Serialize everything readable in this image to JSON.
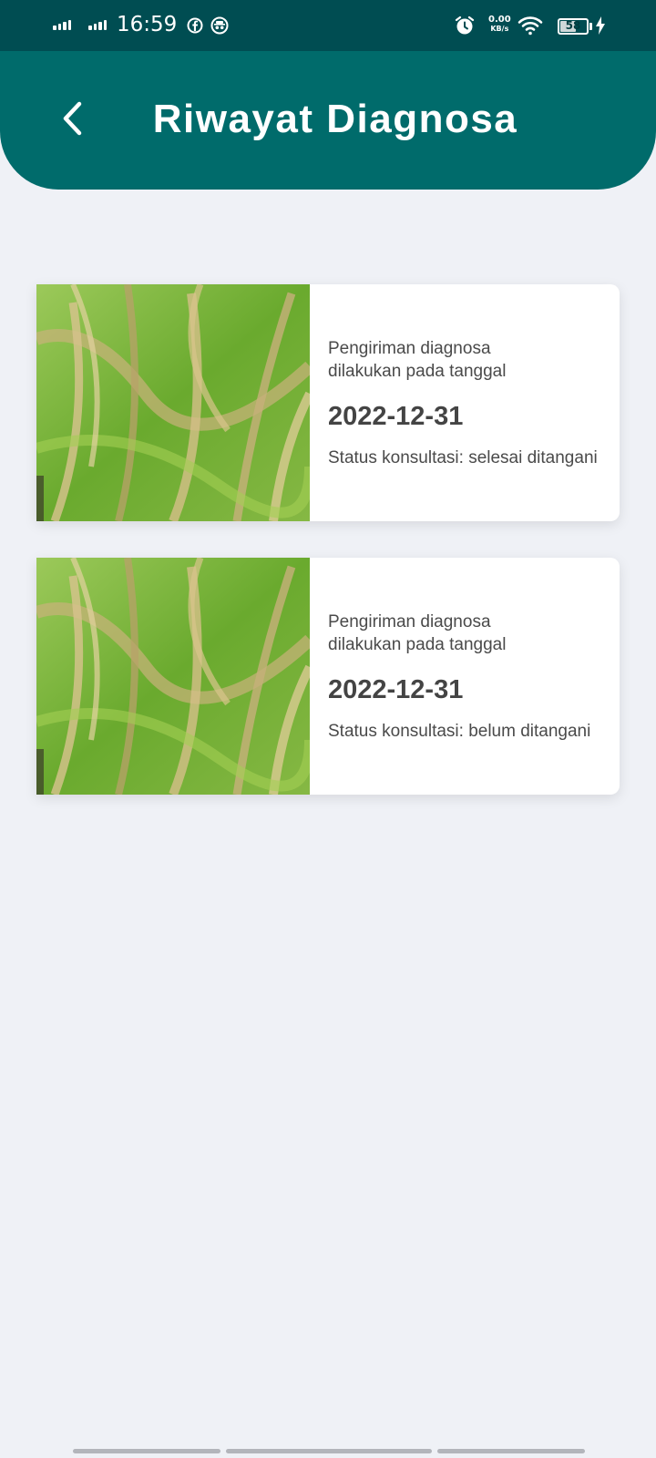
{
  "status_bar": {
    "time": "16:59",
    "network_speed_value": "0.00",
    "network_speed_unit": "KB/s",
    "battery_level": "58",
    "icons": [
      "signal-icon",
      "signal-icon",
      "facebook-icon",
      "incognito-icon",
      "alarm-icon",
      "wifi-icon",
      "battery-icon",
      "charging-icon"
    ]
  },
  "app_bar": {
    "title": "Riwayat Diagnosa",
    "back_icon": "chevron-left-icon",
    "color": "#006b6b"
  },
  "diagnoses": [
    {
      "image": "rice-plant-photo",
      "label": "Pengiriman diagnosa\ndilakukan pada tanggal",
      "date": "2022-12-31",
      "status": "Status konsultasi: selesai ditangani"
    },
    {
      "image": "rice-plant-photo",
      "label": "Pengiriman diagnosa\ndilakukan pada tanggal",
      "date": "2022-12-31",
      "status": "Status konsultasi: belum ditangani"
    }
  ],
  "colors": {
    "status_bar": "#004d52",
    "background": "#eff1f6",
    "card": "#ffffff",
    "text": "#4a4a4a"
  }
}
